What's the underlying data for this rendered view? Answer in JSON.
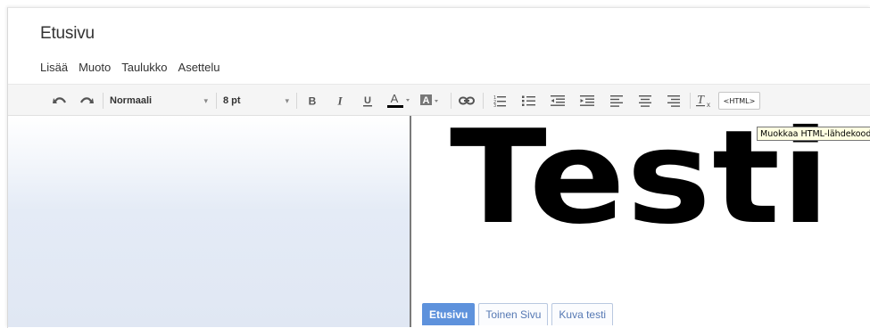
{
  "page": {
    "title": "Etusivu"
  },
  "menu": [
    {
      "label": "Lisää"
    },
    {
      "label": "Muoto"
    },
    {
      "label": "Taulukko"
    },
    {
      "label": "Asettelu"
    }
  ],
  "toolbar": {
    "font_family": "Normaali",
    "font_size": "8 pt",
    "html_button": "<HTML>",
    "tooltip": "Muokkaa HTML-lähdekoodia"
  },
  "content": {
    "heading": "Testi"
  },
  "page_tabs": [
    {
      "label": "Etusivu",
      "active": true
    },
    {
      "label": "Toinen Sivu",
      "active": false
    },
    {
      "label": "Kuva testi",
      "active": false
    }
  ],
  "colors": {
    "active_tab": "#5e92dc",
    "tab_text": "#5578b3",
    "tooltip_bg": "#ffffe1"
  },
  "icons": [
    "undo-icon",
    "redo-icon",
    "bold-icon",
    "italic-icon",
    "underline-icon",
    "text-color-icon",
    "highlight-color-icon",
    "link-icon",
    "numbered-list-icon",
    "bulleted-list-icon",
    "indent-less-icon",
    "indent-more-icon",
    "align-left-icon",
    "align-center-icon",
    "align-right-icon",
    "clear-formatting-icon"
  ]
}
